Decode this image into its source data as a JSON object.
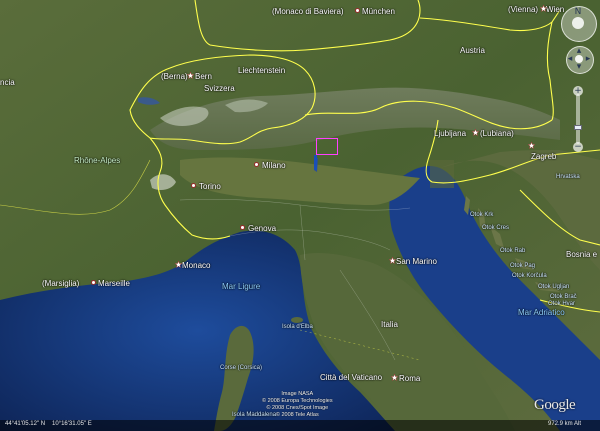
{
  "map": {
    "type": "satellite",
    "colors": {
      "border": "#ffff4d",
      "sea": "#1a3f8a",
      "land": "#4f6a34",
      "placemark": "#ff40ff"
    }
  },
  "labels": {
    "munchen_alt": "(Monaco di Baviera)",
    "munchen": "München",
    "wien_alt": "(Vienna)",
    "wien": "Wien",
    "berna": "(Berna)",
    "bern": "Bern",
    "liechtenstein": "Liechtenstein",
    "svizzera": "Svizzera",
    "austria": "Austria",
    "francia_partial": "ncia",
    "rhone_alpes": "Rhône-Alpes",
    "milano": "Milano",
    "torino": "Torino",
    "ljubljana": "Ljubljana",
    "lubiana": "(Lubiana)",
    "zagreb": "Zagreb",
    "hrvatska_partial": "Hrvatska",
    "genova": "Genova",
    "monaco": "Monaco",
    "marseille_alt": "(Marsiglia)",
    "marseille": "Marseille",
    "mar_ligure": "Mar Ligure",
    "san_marino": "San Marino",
    "italia": "Italia",
    "bosnia": "Bosnia e",
    "mar_adriatico": "Mar Adriatico",
    "isola_elba": "Isola d'Elba",
    "corse": "Corse (Corsica)",
    "vaticano": "Città del Vaticano",
    "roma": "Roma",
    "isola_maddalena": "Isola Maddalena",
    "otok_krk": "Otok Krk",
    "otok_cres": "Otok Cres",
    "otok_rab": "Otok Rab",
    "otok_pag": "Otok Pag",
    "otok_ugljan": "Otok Ugljan",
    "otok_korcula": "Otok Korčula",
    "otok_brac": "Otok Brač",
    "otok_hvar": "Otok Hvar"
  },
  "credits": {
    "line1": "Image NASA",
    "line2": "© 2008 Europa Technologies",
    "line3": "© 2008 Cnes/Spot Image",
    "line4": "© 2008 Tele Atlas"
  },
  "status": {
    "lat": "44°41'05.12\" N",
    "lon": "10°16'31.05\" E",
    "alt": "972.9 km    Alt"
  },
  "logo": "Google",
  "nav": {
    "north": "N",
    "zoom_in": "+",
    "zoom_out": "−",
    "zoom_level": 0.7
  }
}
